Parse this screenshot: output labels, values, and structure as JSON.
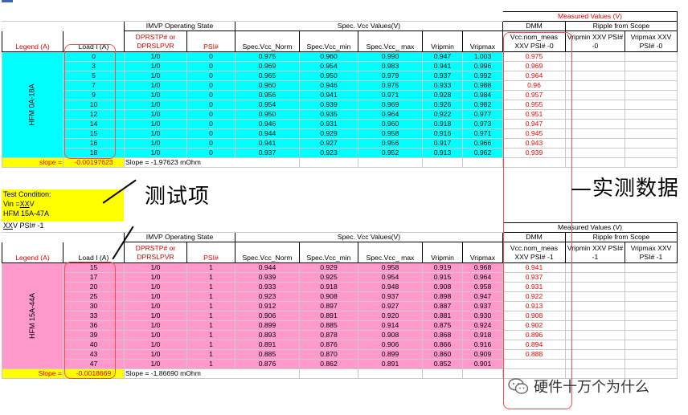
{
  "top": {
    "group_headers": {
      "imvp": "IMVP Operating State",
      "spec": "Spec. Vcc Values(V)",
      "measured": "Measured Values (V)",
      "dmm": "DMM",
      "ripple": "Ripple from Scope"
    },
    "columns": {
      "legend": "Legend (A)",
      "load": "Load I (A)",
      "dprstp": "DPRSTP# or DPRSLPVR",
      "psi": "PSI#",
      "vcc_norm": "Spec.Vcc_Norm",
      "vcc_min": "Spec.Vcc_min",
      "vcc_max": "Spec.Vcc_ max",
      "vripmin": "Vripmin",
      "vripmax": "Vripmax",
      "meas": "Vcc.nom_meas XXV PSI# -0",
      "vripmin_xxv": "Vripmin XXV PSI# -0",
      "vripmax_xxv": "Vripmax XXV PSI# -0"
    },
    "legend_label": "HFM 0A-18A",
    "rows": [
      {
        "load": "0",
        "state": "1/0",
        "psi": "0",
        "norm": "0.975",
        "min": "0.960",
        "max": "0.990",
        "vripmin": "0.947",
        "vripmax": "1.003",
        "meas": "0.975"
      },
      {
        "load": "3",
        "state": "1/0",
        "psi": "0",
        "norm": "0.969",
        "min": "0.954",
        "max": "0.983",
        "vripmin": "0.941",
        "vripmax": "0.996",
        "meas": "0.969"
      },
      {
        "load": "5",
        "state": "1/0",
        "psi": "0",
        "norm": "0.965",
        "min": "0.950",
        "max": "0.979",
        "vripmin": "0.937",
        "vripmax": "0.992",
        "meas": "0.964"
      },
      {
        "load": "7",
        "state": "1/0",
        "psi": "0",
        "norm": "0.960",
        "min": "0.946",
        "max": "0.975",
        "vripmin": "0.933",
        "vripmax": "0.988",
        "meas": "0.96"
      },
      {
        "load": "9",
        "state": "1/0",
        "psi": "0",
        "norm": "0.956",
        "min": "0.941",
        "max": "0.971",
        "vripmin": "0.928",
        "vripmax": "0.984",
        "meas": "0.957"
      },
      {
        "load": "10",
        "state": "1/0",
        "psi": "0",
        "norm": "0.954",
        "min": "0.939",
        "max": "0.969",
        "vripmin": "0.926",
        "vripmax": "0.982",
        "meas": "0.955"
      },
      {
        "load": "12",
        "state": "1/0",
        "psi": "0",
        "norm": "0.950",
        "min": "0.935",
        "max": "0.964",
        "vripmin": "0.922",
        "vripmax": "0.977",
        "meas": "0.951"
      },
      {
        "load": "14",
        "state": "1/0",
        "psi": "0",
        "norm": "0.946",
        "min": "0.931",
        "max": "0.960",
        "vripmin": "0.918",
        "vripmax": "0.973",
        "meas": "0.947"
      },
      {
        "load": "15",
        "state": "1/0",
        "psi": "0",
        "norm": "0.944",
        "min": "0.929",
        "max": "0.958",
        "vripmin": "0.916",
        "vripmax": "0.971",
        "meas": "0.945"
      },
      {
        "load": "16",
        "state": "1/0",
        "psi": "0",
        "norm": "0.941",
        "min": "0.927",
        "max": "0.956",
        "vripmin": "0.917",
        "vripmax": "0.966",
        "meas": "0.943"
      },
      {
        "load": "18",
        "state": "1/0",
        "psi": "0",
        "norm": "0.937",
        "min": "0.923",
        "max": "0.952",
        "vripmin": "0.913",
        "vripmax": "0.962",
        "meas": "0.939"
      }
    ],
    "slope_label": "slope =",
    "slope_value": "-0.00197623",
    "slope_note": "Slope = -1.97623 mOhm"
  },
  "test_condition": {
    "line1": "Test Condition:",
    "line2": "Vin =XXV",
    "line3": "HFM 15A-47A",
    "line4": "XXV PSI# -1"
  },
  "bottom": {
    "group_headers": {
      "imvp": "IMVP Operating State",
      "spec": "Spec. Vcc Values(V)",
      "measured": "Measured Values (V)",
      "dmm": "DMM",
      "ripple": "Ripple from Scope"
    },
    "columns": {
      "legend": "Legend (A)",
      "load": "Load I (A)",
      "dprstp": "DPRSTP# or DPRSLPVR",
      "psi": "PSI#",
      "vcc_norm": "Spec.Vcc_Norm",
      "vcc_min": "Spec.Vcc_min",
      "vcc_max": "Spec.Vcc_ max",
      "vripmin": "Vripmin",
      "vripmax": "Vripmax",
      "meas": "Vcc.nom_meas XXV PSI# -1",
      "vripmin_xxv": "Vripmin XXV PSI# -1",
      "vripmax_xxv": "Vripmax XXV PSI# -1"
    },
    "legend_label": "HFM 15A-44A",
    "rows": [
      {
        "load": "15",
        "state": "1/0",
        "psi": "1",
        "norm": "0.944",
        "min": "0.929",
        "max": "0.958",
        "vripmin": "0.919",
        "vripmax": "0.968",
        "meas": "0.941"
      },
      {
        "load": "17",
        "state": "1/0",
        "psi": "1",
        "norm": "0.939",
        "min": "0.925",
        "max": "0.954",
        "vripmin": "0.915",
        "vripmax": "0.964",
        "meas": "0.937"
      },
      {
        "load": "20",
        "state": "1/0",
        "psi": "1",
        "norm": "0.933",
        "min": "0.918",
        "max": "0.948",
        "vripmin": "0.908",
        "vripmax": "0.958",
        "meas": "0.931"
      },
      {
        "load": "25",
        "state": "1/0",
        "psi": "1",
        "norm": "0.923",
        "min": "0.908",
        "max": "0.937",
        "vripmin": "0.898",
        "vripmax": "0.947",
        "meas": "0.922"
      },
      {
        "load": "30",
        "state": "1/0",
        "psi": "1",
        "norm": "0.912",
        "min": "0.897",
        "max": "0.927",
        "vripmin": "0.887",
        "vripmax": "0.937",
        "meas": "0.913"
      },
      {
        "load": "33",
        "state": "1/0",
        "psi": "1",
        "norm": "0.906",
        "min": "0.891",
        "max": "0.920",
        "vripmin": "0.881",
        "vripmax": "0.930",
        "meas": "0.908"
      },
      {
        "load": "36",
        "state": "1/0",
        "psi": "1",
        "norm": "0.899",
        "min": "0.885",
        "max": "0.914",
        "vripmin": "0.875",
        "vripmax": "0.924",
        "meas": "0.902"
      },
      {
        "load": "39",
        "state": "1/0",
        "psi": "1",
        "norm": "0.893",
        "min": "0.878",
        "max": "0.908",
        "vripmin": "0.868",
        "vripmax": "0.918",
        "meas": "0.896"
      },
      {
        "load": "40",
        "state": "1/0",
        "psi": "1",
        "norm": "0.891",
        "min": "0.876",
        "max": "0.906",
        "vripmin": "0.866",
        "vripmax": "0.916",
        "meas": "0.894"
      },
      {
        "load": "43",
        "state": "1/0",
        "psi": "1",
        "norm": "0.885",
        "min": "0.870",
        "max": "0.899",
        "vripmin": "0.860",
        "vripmax": "0.909",
        "meas": "0.888"
      },
      {
        "load": "47",
        "state": "1/0",
        "psi": "1",
        "norm": "0.876",
        "min": "0.862",
        "max": "0.891",
        "vripmin": "0.852",
        "vripmax": "0.901",
        "meas": ""
      }
    ],
    "slope_label": "Slope =",
    "slope_value": "-0.0018669",
    "slope_note": "Slope = -1.86690 mOhm"
  },
  "annotations": {
    "test_items": "测试项",
    "measured_data": "—实测数据"
  },
  "watermark": {
    "text": "硬件十万个为什么"
  },
  "colors": {
    "cyan": "#00ffff",
    "pink": "#ff99cc",
    "yellow": "#ffff00",
    "measured_red": "#ff0000",
    "annotation_red": "#ff4a4a"
  }
}
